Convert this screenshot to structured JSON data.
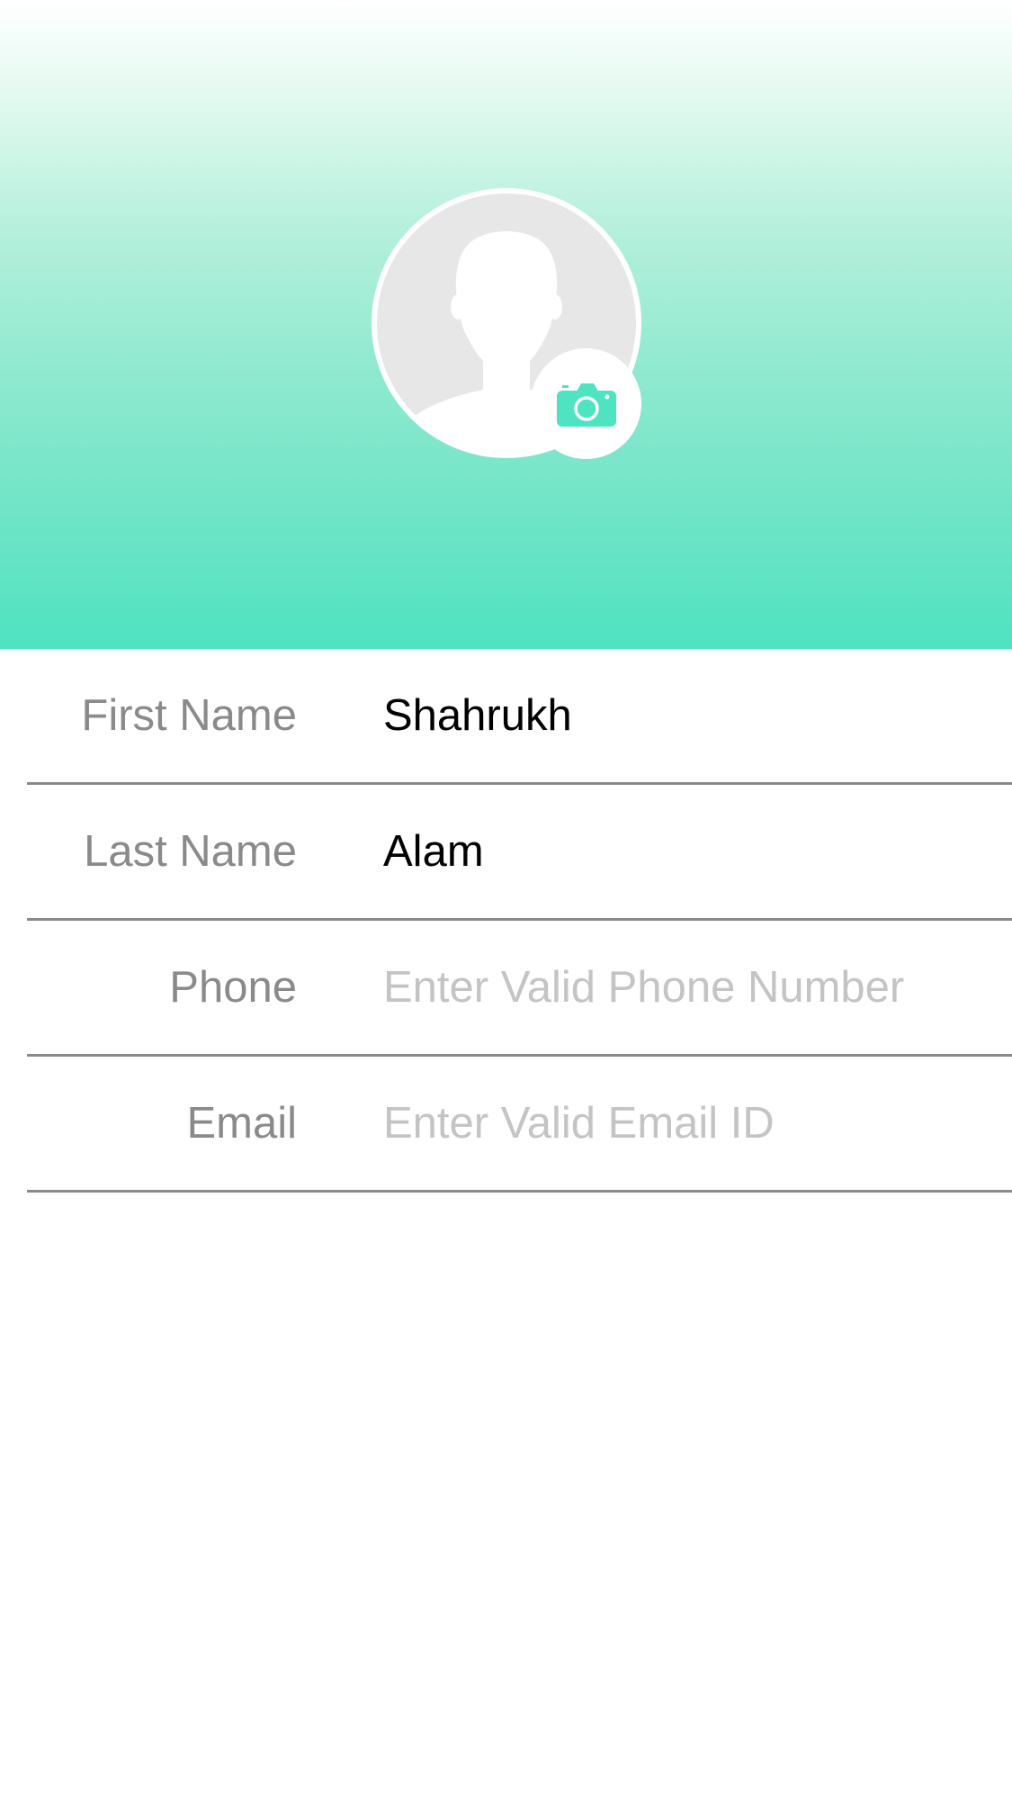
{
  "header": {
    "avatar_icon": "user-silhouette-icon",
    "camera_icon": "camera-icon",
    "accent_color": "#4ee3c1"
  },
  "form": {
    "first_name": {
      "label": "First Name",
      "value": "Shahrukh",
      "placeholder": ""
    },
    "last_name": {
      "label": "Last Name",
      "value": "Alam",
      "placeholder": ""
    },
    "phone": {
      "label": "Phone",
      "value": "",
      "placeholder": "Enter Valid Phone Number"
    },
    "email": {
      "label": "Email",
      "value": "",
      "placeholder": "Enter Valid Email ID"
    }
  }
}
